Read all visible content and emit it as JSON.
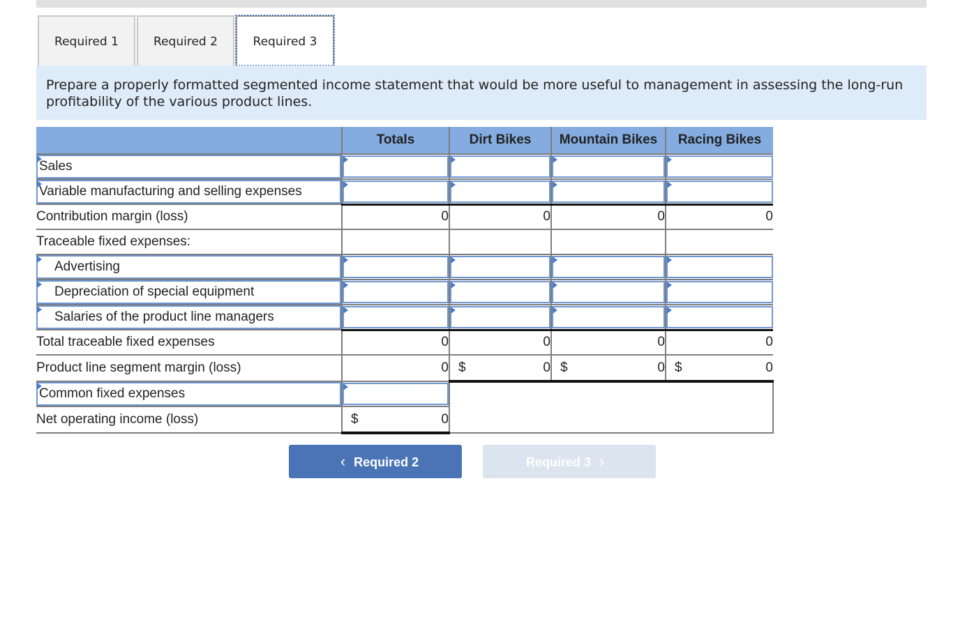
{
  "tabs": [
    {
      "label": "Required 1",
      "active": false
    },
    {
      "label": "Required 2",
      "active": false
    },
    {
      "label": "Required 3",
      "active": true
    }
  ],
  "instruction": "Prepare a properly formatted segmented income statement that would be more useful to management in assessing the long-run profitability of the various product lines.",
  "table": {
    "columns": [
      "Totals",
      "Dirt Bikes",
      "Mountain Bikes",
      "Racing Bikes"
    ],
    "rows": {
      "sales": {
        "label": "Sales",
        "values": [
          "",
          "",
          "",
          ""
        ]
      },
      "variable": {
        "label": "Variable manufacturing and selling expenses",
        "values": [
          "",
          "",
          "",
          ""
        ]
      },
      "contribution": {
        "label": "Contribution margin (loss)",
        "values": [
          "0",
          "0",
          "0",
          "0"
        ]
      },
      "traceable_header": {
        "label": "Traceable fixed expenses:"
      },
      "advertising": {
        "label": "Advertising",
        "values": [
          "",
          "",
          "",
          ""
        ]
      },
      "depreciation": {
        "label": "Depreciation of special equipment",
        "values": [
          "",
          "",
          "",
          ""
        ]
      },
      "salaries": {
        "label": "Salaries of the product line managers",
        "values": [
          "",
          "",
          "",
          ""
        ]
      },
      "total_traceable": {
        "label": "Total traceable fixed expenses",
        "values": [
          "0",
          "0",
          "0",
          "0"
        ]
      },
      "segment_margin": {
        "label": "Product line segment margin (loss)",
        "values": [
          "0",
          "0",
          "0",
          "0"
        ],
        "currency": [
          "",
          "$",
          "$",
          "$"
        ]
      },
      "common": {
        "label": "Common fixed expenses",
        "values": [
          ""
        ]
      },
      "net": {
        "label": "Net operating income (loss)",
        "values": [
          "0"
        ],
        "currency": [
          "$"
        ]
      }
    }
  },
  "nav": {
    "prev_label": "Required 2",
    "next_label": "Required 3",
    "prev_icon": "chevron-left-icon",
    "next_icon": "chevron-right-icon",
    "next_disabled": true
  }
}
